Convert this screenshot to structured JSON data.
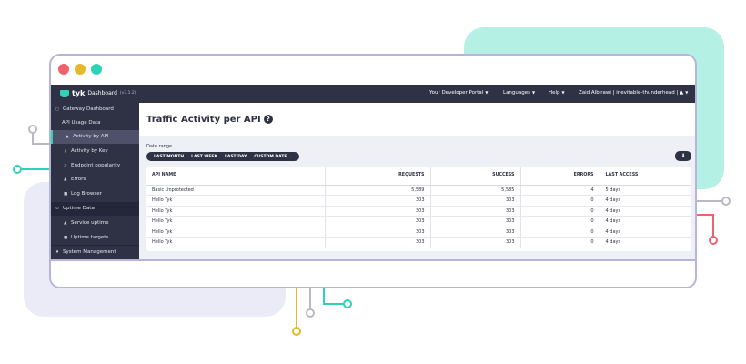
{
  "window": {
    "colors": {
      "close": "#f0616d",
      "minimize": "#e4b92b",
      "maximize": "#2ed3b7"
    }
  },
  "topnav": {
    "logo_word": "tyk",
    "app_name": "Dashboard",
    "version": "(v3.1.2)",
    "items": [
      {
        "label": "Your Developer Portal",
        "icon": "caret-down-icon"
      },
      {
        "label": "Languages",
        "icon": "caret-down-icon"
      },
      {
        "label": "Help",
        "icon": "caret-down-icon"
      },
      {
        "label": "Zaid Albirawi | inevitable-thunderhead | ▲",
        "icon": "caret-down-icon"
      }
    ]
  },
  "sidebar": {
    "items": [
      {
        "label": "Gateway Dashboard",
        "icon": "dashboard-icon"
      },
      {
        "label": "API Usage Data",
        "icon": ""
      },
      {
        "label": "Activity by API",
        "icon": "bar-chart-icon",
        "active": true
      },
      {
        "label": "Activity by Key",
        "icon": "key-icon"
      },
      {
        "label": "Endpoint popularity",
        "icon": "endpoint-icon"
      },
      {
        "label": "Errors",
        "icon": "error-icon"
      },
      {
        "label": "Log Browser",
        "icon": "log-icon"
      },
      {
        "label": "Uptime Data",
        "icon": "uptime-icon"
      },
      {
        "label": "Service uptime",
        "icon": "service-icon"
      },
      {
        "label": "Uptime targets",
        "icon": "target-icon"
      },
      {
        "label": "System Management",
        "icon": "system-icon"
      }
    ]
  },
  "main": {
    "title": "Traffic Activity per API",
    "help_icon": "question-icon",
    "date_range_label": "Date range",
    "range_buttons": [
      "LAST MONTH",
      "LAST WEEK",
      "LAST DAY",
      "CUSTOM DATE"
    ],
    "download_icon": "download-icon",
    "table": {
      "headers": [
        "API NAME",
        "REQUESTS",
        "SUCCESS",
        "ERRORS",
        "LAST ACCESS"
      ],
      "rows": [
        [
          "Basic Unprotected",
          "5,589",
          "5,585",
          "4",
          "5 days"
        ],
        [
          "Hello Tyk",
          "303",
          "303",
          "0",
          "4 days"
        ],
        [
          "Hello Tyk",
          "303",
          "303",
          "0",
          "4 days"
        ],
        [
          "Hello Tyk",
          "303",
          "303",
          "0",
          "4 days"
        ],
        [
          "Hello Tyk",
          "303",
          "303",
          "0",
          "4 days"
        ],
        [
          "Hello Tyk",
          "303",
          "303",
          "0",
          "4 days"
        ]
      ]
    }
  },
  "theme": {
    "nav_bg": "#2f3144",
    "accent": "#2ed3b7",
    "panel_bg": "#eff0f6",
    "window_border": "#b7b4dc",
    "bg_teal": "#b4f0e4",
    "bg_lavender": "#eaebf6",
    "wire_coral": "#f0616d",
    "wire_gold": "#e4b92b",
    "wire_gray": "#b9b9c6"
  }
}
